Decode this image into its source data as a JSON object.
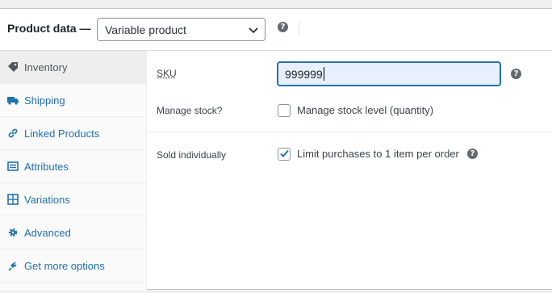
{
  "header": {
    "title": "Product data —",
    "product_type": "Variable product"
  },
  "tabs": [
    {
      "label": "Inventory",
      "icon": "inventory-icon",
      "active": true
    },
    {
      "label": "Shipping",
      "icon": "truck-icon"
    },
    {
      "label": "Linked Products",
      "icon": "link-icon"
    },
    {
      "label": "Attributes",
      "icon": "list-icon"
    },
    {
      "label": "Variations",
      "icon": "grid-icon"
    },
    {
      "label": "Advanced",
      "icon": "gear-icon"
    },
    {
      "label": "Get more options",
      "icon": "plugin-icon"
    }
  ],
  "inventory": {
    "sku_label": "SKU",
    "sku_value": "999999",
    "manage_stock_label": "Manage stock?",
    "manage_stock_text": "Manage stock level (quantity)",
    "manage_stock_checked": false,
    "sold_individually_label": "Sold individually",
    "sold_individually_text": "Limit purchases to 1 item per order",
    "sold_individually_checked": true
  },
  "colors": {
    "link": "#2271b1",
    "focus_border": "#2271b1",
    "input_autofill_bg": "#e8f0fe",
    "help_icon": "#646970"
  }
}
